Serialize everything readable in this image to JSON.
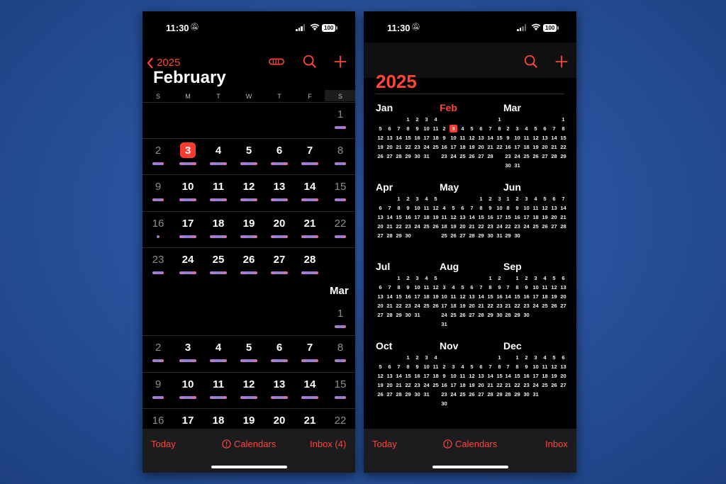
{
  "status": {
    "time": "11:30",
    "battery": "100"
  },
  "left": {
    "back_label": "2025",
    "month_title": "February",
    "weekdays": [
      "S",
      "M",
      "T",
      "W",
      "T",
      "F",
      "S"
    ],
    "next_month_label": "Mar",
    "weeks": [
      [
        null,
        null,
        null,
        null,
        null,
        null,
        "1"
      ],
      [
        "2",
        "3",
        "4",
        "5",
        "6",
        "7",
        "8"
      ],
      [
        "9",
        "10",
        "11",
        "12",
        "13",
        "14",
        "15"
      ],
      [
        "16",
        "17",
        "18",
        "19",
        "20",
        "21",
        "22"
      ],
      [
        "23",
        "24",
        "25",
        "26",
        "27",
        "28",
        null
      ],
      [
        null,
        null,
        null,
        null,
        null,
        null,
        "1"
      ],
      [
        "2",
        "3",
        "4",
        "5",
        "6",
        "7",
        "8"
      ],
      [
        "9",
        "10",
        "11",
        "12",
        "13",
        "14",
        "15"
      ],
      [
        "16",
        "17",
        "18",
        "19",
        "20",
        "21",
        "22"
      ]
    ],
    "today": "3",
    "tabbar": {
      "today": "Today",
      "calendars": "Calendars",
      "inbox": "Inbox (4)"
    }
  },
  "right": {
    "year_title": "2025",
    "months": [
      {
        "name": "Jan",
        "start": 3,
        "days": 31
      },
      {
        "name": "Feb",
        "start": 6,
        "days": 28,
        "today": 3
      },
      {
        "name": "Mar",
        "start": 6,
        "days": 31
      },
      {
        "name": "Apr",
        "start": 2,
        "days": 30
      },
      {
        "name": "May",
        "start": 4,
        "days": 31
      },
      {
        "name": "Jun",
        "start": 0,
        "days": 30
      },
      {
        "name": "Jul",
        "start": 2,
        "days": 31
      },
      {
        "name": "Aug",
        "start": 5,
        "days": 31
      },
      {
        "name": "Sep",
        "start": 1,
        "days": 30
      },
      {
        "name": "Oct",
        "start": 3,
        "days": 31
      },
      {
        "name": "Nov",
        "start": 6,
        "days": 30
      },
      {
        "name": "Dec",
        "start": 1,
        "days": 31
      }
    ],
    "tabbar": {
      "today": "Today",
      "calendars": "Calendars",
      "inbox": "Inbox"
    }
  },
  "colors": {
    "accent": "#ff453a",
    "today_bg": "#ff3b30"
  },
  "icons": [
    "back-chevron-icon",
    "list-view-icon",
    "search-icon",
    "add-icon",
    "alert-circle-icon"
  ]
}
